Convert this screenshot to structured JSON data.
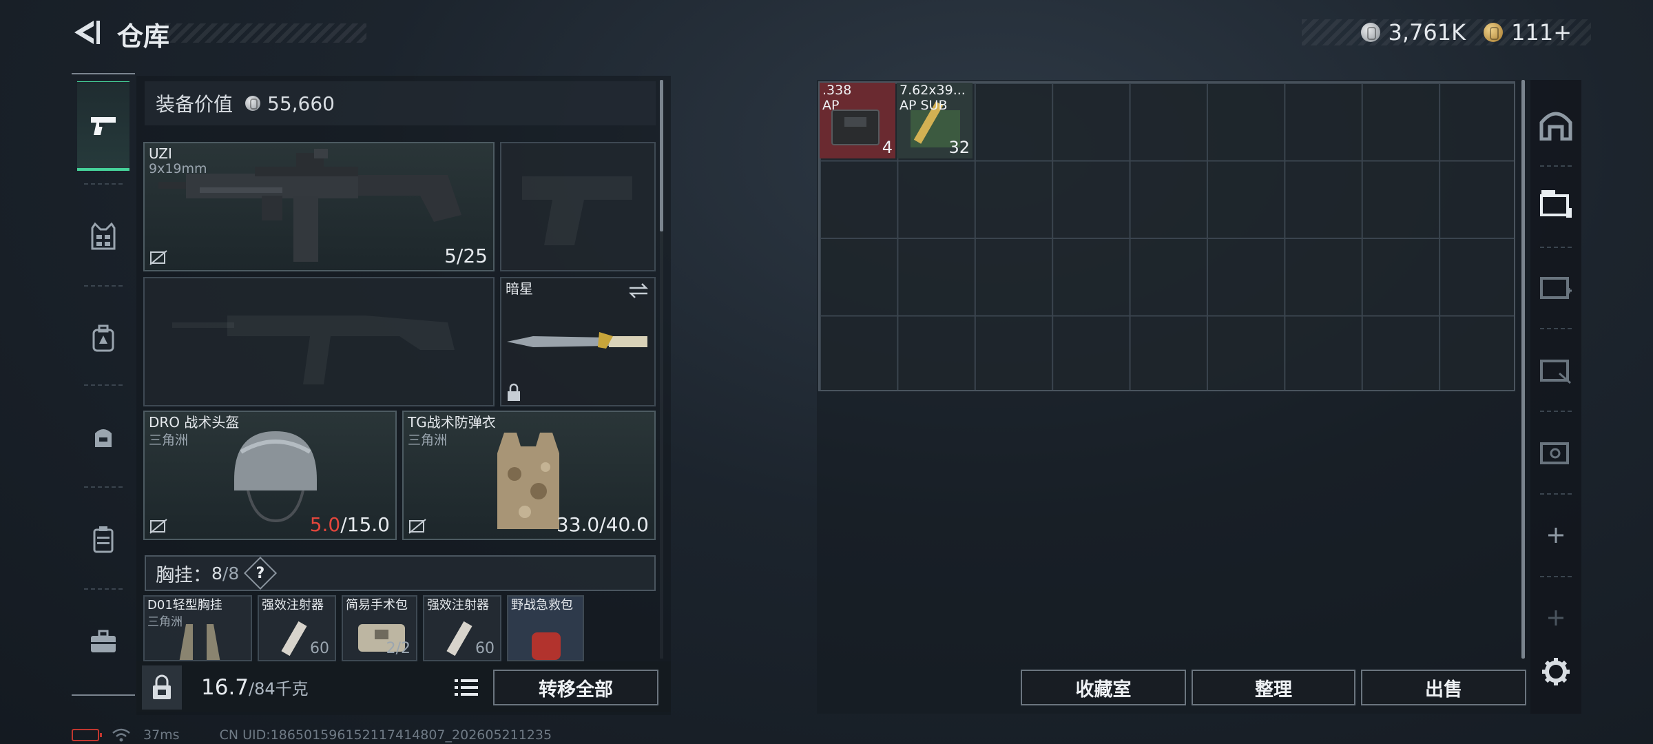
{
  "header": {
    "title": "仓库",
    "currencies": [
      {
        "icon": "silver-coin-icon",
        "value": "3,761K"
      },
      {
        "icon": "gold-coin-icon",
        "value": "111+"
      }
    ]
  },
  "sidebar": {
    "items": [
      {
        "icon": "pistol-icon",
        "active": true
      },
      {
        "icon": "vest-icon",
        "active": false
      },
      {
        "icon": "backpack-icon",
        "active": false
      },
      {
        "icon": "small-backpack-icon",
        "active": false
      },
      {
        "icon": "case-icon",
        "active": false
      },
      {
        "icon": "toolbox-icon",
        "active": false
      }
    ]
  },
  "loadout": {
    "equip_value_label": "装备价值",
    "equip_value": "55,660",
    "primary": {
      "name": "UZI",
      "ammo": "9x19mm",
      "count": "5/25"
    },
    "melee": {
      "name": "暗星"
    },
    "helmet": {
      "name": "DRO 战术头盔",
      "origin": "三角洲",
      "durability_current": "5.0",
      "durability_max": "/15.0"
    },
    "armor": {
      "name": "TG战术防弹衣",
      "origin": "三角洲",
      "durability": "33.0/40.0"
    },
    "chest_rig": {
      "label": "胸挂：",
      "used": "8",
      "capacity": "/8",
      "help": "?"
    },
    "chest_items": [
      {
        "name": "D01轻型胸挂",
        "sub": "三角洲",
        "count": ""
      },
      {
        "name": "强效注射器",
        "sub": "",
        "count": "60"
      },
      {
        "name": "简易手术包",
        "sub": "",
        "count": "2/2"
      },
      {
        "name": "强效注射器",
        "sub": "",
        "count": "60"
      },
      {
        "name": "野战急救包",
        "sub": "",
        "count": ""
      }
    ],
    "weight_current": "16.7",
    "weight_max": "/84千克",
    "transfer_all": "转移全部"
  },
  "stash": {
    "items": [
      {
        "name1": ".338",
        "name2": "AP",
        "count": "4",
        "color": "#6a2a30"
      },
      {
        "name1": "7.62x39...",
        "name2": "AP SUB",
        "count": "32",
        "color": "#2d3a3a"
      }
    ],
    "buttons": {
      "collection": "收藏室",
      "organize": "整理",
      "sell": "出售"
    }
  },
  "status": {
    "ping": "37ms",
    "uid": "CN UID:18650159615211741480​7_202605211235"
  }
}
